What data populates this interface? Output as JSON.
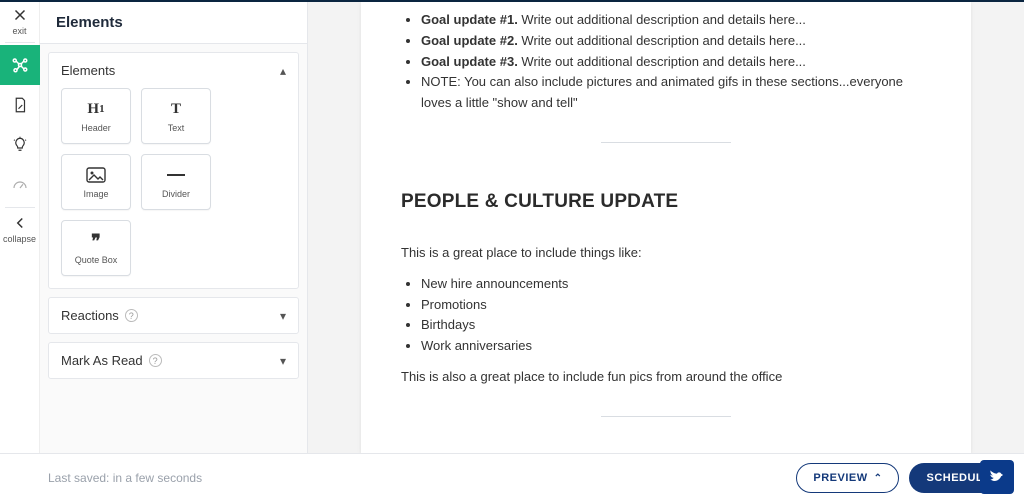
{
  "rail": {
    "exit": "exit",
    "collapse": "collapse"
  },
  "panel": {
    "title": "Elements",
    "sections": {
      "elements": {
        "label": "Elements"
      },
      "reactions": {
        "label": "Reactions"
      },
      "mark_as_read": {
        "label": "Mark As Read"
      }
    },
    "tiles": {
      "header": "Header",
      "text": "Text",
      "image": "Image",
      "divider": "Divider",
      "quote": "Quote Box"
    }
  },
  "doc": {
    "goals": [
      {
        "bold": "Goal update #1.",
        "rest": " Write out additional description and details here..."
      },
      {
        "bold": "Goal update #2.",
        "rest": " Write out additional description and details here..."
      },
      {
        "bold": "Goal update #3.",
        "rest": " Write out additional description and details here..."
      }
    ],
    "note": "NOTE: You can also include pictures and animated gifs in these sections...everyone loves a little \"show and tell\"",
    "h2": "PEOPLE & CULTURE UPDATE",
    "intro": "This is a great place to include things like:",
    "bullets": [
      "New hire announcements",
      "Promotions",
      "Birthdays",
      "Work anniversaries"
    ],
    "outro": "This is also a great place to include fun pics from around the office"
  },
  "footer": {
    "saved": "Last saved: in a few seconds",
    "preview": "PREVIEW",
    "schedule": "SCHEDULE"
  }
}
